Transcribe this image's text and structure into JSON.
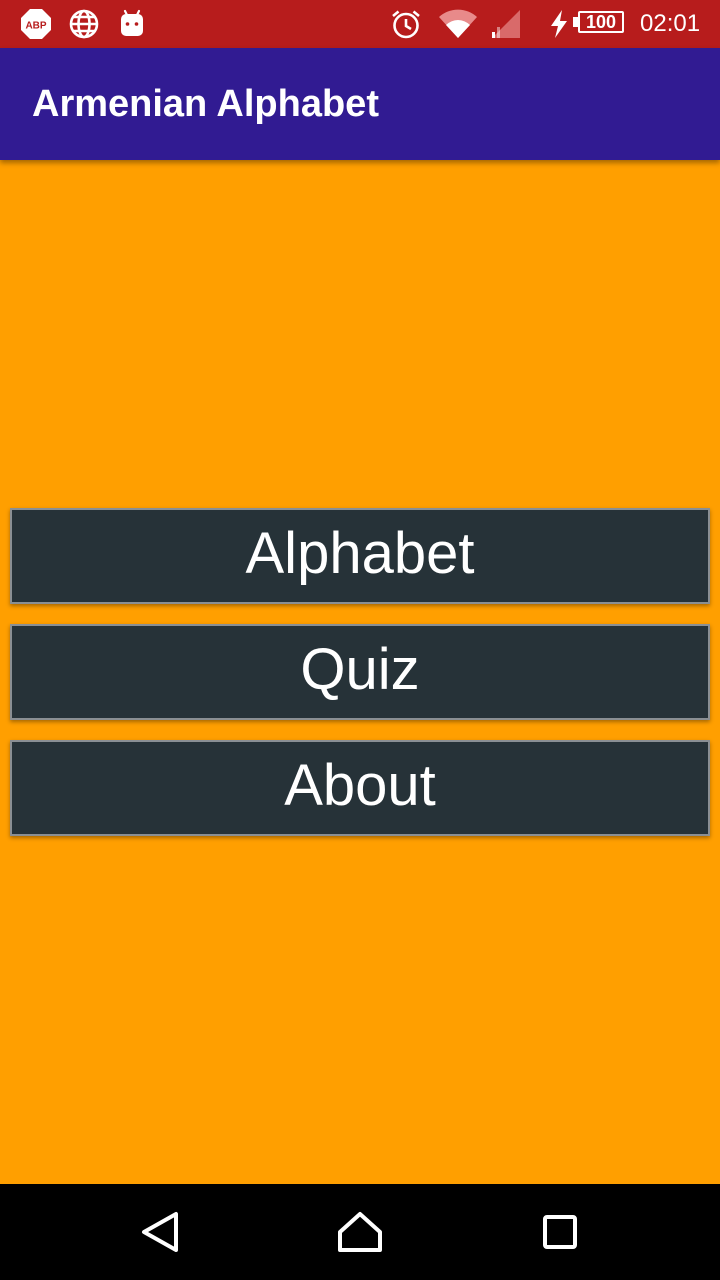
{
  "status_bar": {
    "adblock_label": "ABP",
    "battery_level": "100",
    "time": "02:01",
    "icons": [
      "adblock-icon",
      "globe-icon",
      "android-icon",
      "alarm-icon",
      "wifi-icon",
      "signal-icon",
      "charging-icon",
      "battery-icon"
    ],
    "color": "#b71c1c"
  },
  "app_bar": {
    "title": "Armenian Alphabet",
    "color": "#311b92"
  },
  "content": {
    "background": "#ff9f00",
    "buttons": [
      {
        "label": "Alphabet"
      },
      {
        "label": "Quiz"
      },
      {
        "label": "About"
      }
    ],
    "button_color": "#263238"
  },
  "nav_bar": {
    "icons": [
      "back-icon",
      "home-icon",
      "recents-icon"
    ]
  }
}
